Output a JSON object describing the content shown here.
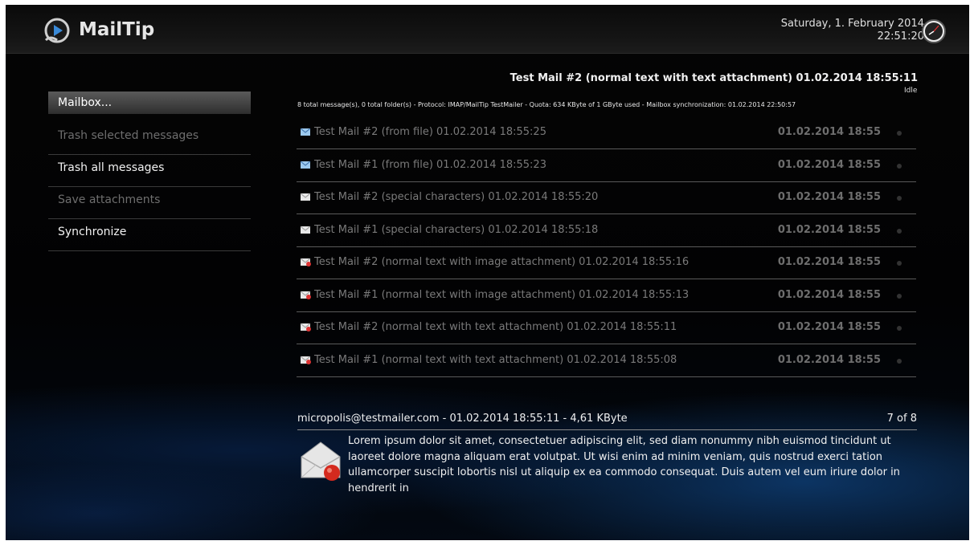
{
  "app": {
    "title": "MailTip"
  },
  "header": {
    "date": "Saturday, 1. February 2014",
    "time": "22:51:20"
  },
  "menu": {
    "items": [
      {
        "label": "Mailbox...",
        "state": "active"
      },
      {
        "label": "Trash selected messages",
        "state": "disabled"
      },
      {
        "label": "Trash all messages",
        "state": "enabled"
      },
      {
        "label": "Save attachments",
        "state": "disabled"
      },
      {
        "label": "Synchronize",
        "state": "enabled"
      }
    ]
  },
  "mailbox": {
    "selected_title": "Test Mail #2 (normal text with text attachment) 01.02.2014 18:55:11",
    "status": "Idle",
    "info": "8 total message(s), 0 total folder(s) - Protocol: IMAP/MailTip TestMailer - Quota: 634 KByte of 1 GByte used - Mailbox synchronization: 01.02.2014 22:50:57",
    "messages": [
      {
        "subject": "Test Mail #2 (from file) 01.02.2014 18:55:25",
        "date": "01.02.2014 18:55",
        "icon": "blue-mail-icon"
      },
      {
        "subject": "Test Mail #1 (from file) 01.02.2014 18:55:23",
        "date": "01.02.2014 18:55",
        "icon": "blue-mail-icon"
      },
      {
        "subject": "Test Mail #2 (special characters) 01.02.2014 18:55:20",
        "date": "01.02.2014 18:55",
        "icon": "white-mail-icon"
      },
      {
        "subject": "Test Mail #1 (special characters) 01.02.2014 18:55:18",
        "date": "01.02.2014 18:55",
        "icon": "white-mail-icon"
      },
      {
        "subject": "Test Mail #2 (normal text with image attachment) 01.02.2014 18:55:16",
        "date": "01.02.2014 18:55",
        "icon": "attachment-mail-icon"
      },
      {
        "subject": "Test Mail #1 (normal text with image attachment) 01.02.2014 18:55:13",
        "date": "01.02.2014 18:55",
        "icon": "attachment-mail-icon"
      },
      {
        "subject": "Test Mail #2 (normal text with text attachment) 01.02.2014 18:55:11",
        "date": "01.02.2014 18:55",
        "icon": "attachment-mail-icon"
      },
      {
        "subject": "Test Mail #1 (normal text with text attachment) 01.02.2014 18:55:08",
        "date": "01.02.2014 18:55",
        "icon": "attachment-mail-icon"
      }
    ]
  },
  "detail": {
    "sender_line": "micropolis@testmailer.com - 01.02.2014 18:55:11 - 4,61 KByte",
    "position": "7 of 8",
    "body": "Lorem ipsum dolor sit amet, consectetuer adipiscing elit, sed diam nonummy nibh euismod tincidunt ut laoreet dolore magna aliquam erat volutpat. Ut wisi enim ad minim veniam, quis nostrud exerci tation ullamcorper suscipit lobortis nisl ut aliquip ex ea commodo consequat. Duis autem vel eum iriure dolor in hendrerit in"
  },
  "colors": {
    "accent": "#1e5aa0",
    "menu_active_top": "#5a5a5a",
    "menu_active_bottom": "#2e2e2e"
  }
}
